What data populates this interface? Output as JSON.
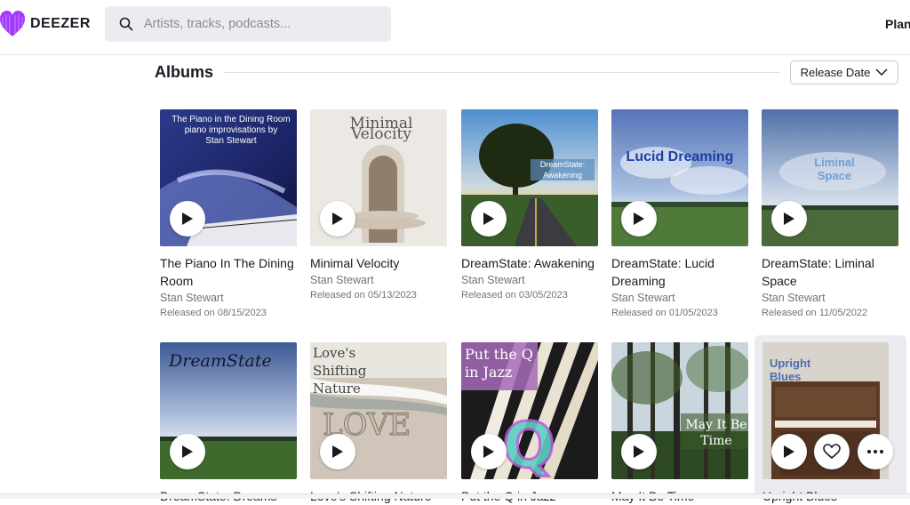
{
  "header": {
    "logo_text": "DEEZER",
    "search_placeholder": "Artists, tracks, podcasts...",
    "plan_label": "Plan"
  },
  "section": {
    "title": "Albums",
    "sort_label": "Release Date"
  },
  "albums": [
    {
      "title": "The Piano In The Dining Room",
      "artist": "Stan Stewart",
      "released": "Released on 08/15/2023",
      "cover_text": "The Piano in the Dining Room\npiano improvisations by\nStan Stewart"
    },
    {
      "title": "Minimal Velocity",
      "artist": "Stan Stewart",
      "released": "Released on 05/13/2023",
      "cover_text": "Minimal Velocity"
    },
    {
      "title": "DreamState: Awakening",
      "artist": "Stan Stewart",
      "released": "Released on 03/05/2023",
      "cover_text": "DreamState: Awakening"
    },
    {
      "title": "DreamState: Lucid Dreaming",
      "artist": "Stan Stewart",
      "released": "Released on 01/05/2023",
      "cover_text": "Lucid Dreaming"
    },
    {
      "title": "DreamState: Liminal Space",
      "artist": "Stan Stewart",
      "released": "Released on 11/05/2022",
      "cover_text": "Liminal Space"
    },
    {
      "title": "DreamState: Dreams",
      "artist": "",
      "released": "",
      "cover_text": "DreamState"
    },
    {
      "title": "Love's Shifting Nature",
      "artist": "",
      "released": "",
      "cover_text": "Love's Shifting Nature"
    },
    {
      "title": "Put the Q in Jazz",
      "artist": "",
      "released": "",
      "cover_text": "Put the Q in Jazz"
    },
    {
      "title": "May It Be Time",
      "artist": "",
      "released": "",
      "cover_text": "May It Be Time"
    },
    {
      "title": "Upright Blues",
      "artist": "",
      "released": "",
      "cover_text": "Upright Blues"
    }
  ],
  "colors": {
    "accent": "#a238ff",
    "text": "#191922",
    "muted": "#72727d"
  }
}
